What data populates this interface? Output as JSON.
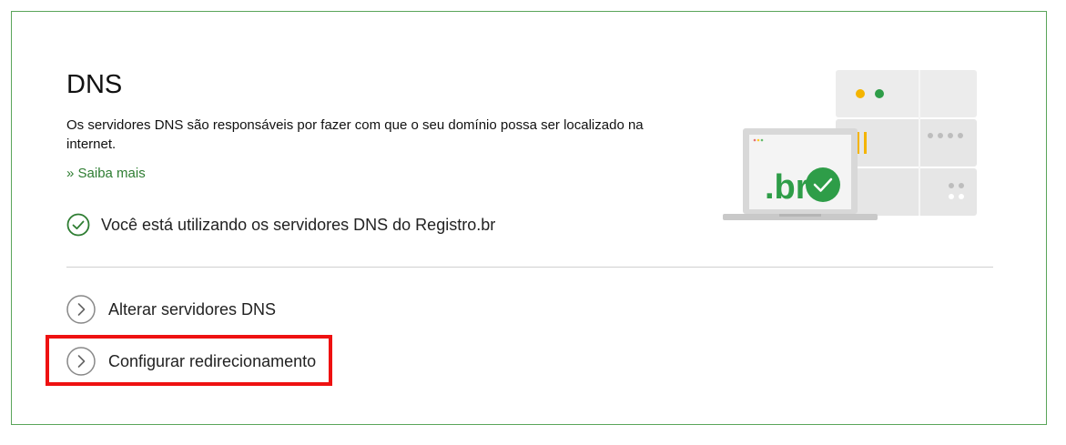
{
  "section": {
    "title": "DNS",
    "description": "Os servidores DNS são responsáveis por fazer com que o seu domínio possa ser localizado na internet.",
    "learn_more": "» Saiba mais",
    "status_text": "Você está utilizando os servidores DNS do Registro.br"
  },
  "actions": [
    {
      "label": "Alterar servidores DNS"
    },
    {
      "label": "Configurar redirecionamento"
    }
  ],
  "illustration": {
    "laptop_logo": ".br"
  },
  "colors": {
    "brand_green": "#2e7d32",
    "check_green": "#2e9d48",
    "card_border": "#5aa55a",
    "highlight_red": "#ee1111",
    "led_yellow": "#f4b400",
    "led_green": "#2e9d48"
  },
  "icons": {
    "status": "check-circle-icon",
    "action": "chevron-right-circle-icon"
  }
}
